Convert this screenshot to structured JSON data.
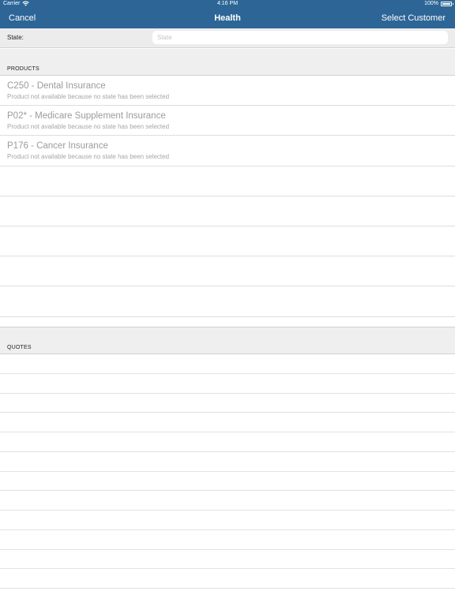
{
  "status_bar": {
    "carrier": "Carrier",
    "time": "4:16 PM",
    "battery": "100%"
  },
  "nav": {
    "cancel_label": "Cancel",
    "title": "Health",
    "select_customer_label": "Select Customer"
  },
  "state": {
    "label": "State:",
    "placeholder": "State",
    "value": ""
  },
  "products": {
    "header": "PRODUCTS",
    "items": [
      {
        "title": "C250 - Dental Insurance",
        "subtitle": "Product not available because no state has been selected"
      },
      {
        "title": "P02* - Medicare Supplement Insurance",
        "subtitle": "Product not available because no state has been selected"
      },
      {
        "title": "P176 - Cancer Insurance",
        "subtitle": "Product not available because no state has been selected"
      }
    ]
  },
  "quotes": {
    "header": "QUOTES"
  },
  "colors": {
    "nav_background": "#2d6696",
    "section_background": "#efefef",
    "disabled_text": "#9b9b9b"
  }
}
